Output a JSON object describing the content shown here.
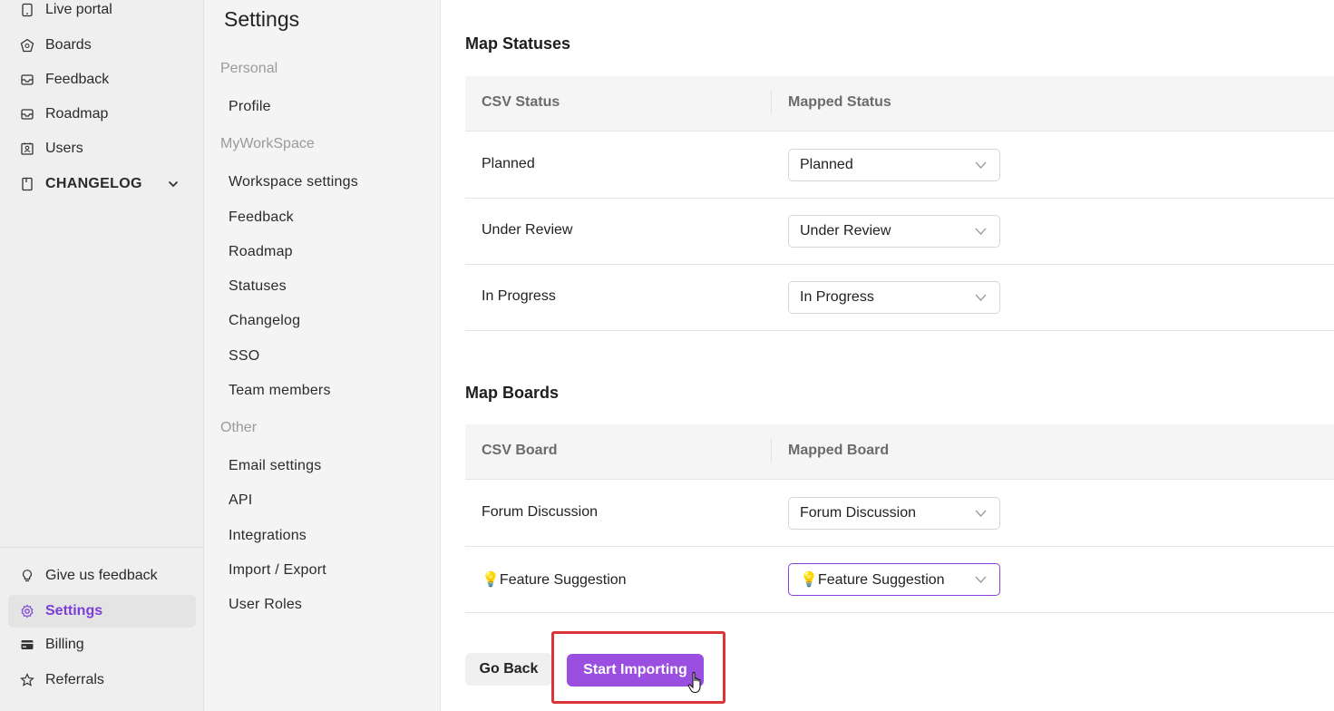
{
  "sidebar": {
    "items": [
      {
        "label": "Live portal",
        "icon": "tablet-icon"
      },
      {
        "label": "Boards",
        "icon": "boards-icon"
      },
      {
        "label": "Feedback",
        "icon": "inbox-icon"
      },
      {
        "label": "Roadmap",
        "icon": "inbox-icon"
      },
      {
        "label": "Users",
        "icon": "contacts-icon"
      },
      {
        "label": "CHANGELOG",
        "icon": "book-icon"
      }
    ],
    "bottom_items": [
      {
        "label": "Give us feedback",
        "icon": "lightbulb-icon"
      },
      {
        "label": "Settings",
        "icon": "gear-icon",
        "active": true
      },
      {
        "label": "Billing",
        "icon": "credit-card-icon"
      },
      {
        "label": "Referrals",
        "icon": "star-icon"
      }
    ]
  },
  "settings_menu": {
    "title": "Settings",
    "sections": [
      {
        "label": "Personal",
        "items": [
          "Profile"
        ]
      },
      {
        "label": "MyWorkSpace",
        "items": [
          "Workspace settings",
          "Feedback",
          "Roadmap",
          "Statuses",
          "Changelog",
          "SSO",
          "Team members"
        ]
      },
      {
        "label": "Other",
        "items": [
          "Email settings",
          "API",
          "Integrations",
          "Import / Export",
          "User Roles"
        ]
      }
    ]
  },
  "map_statuses": {
    "title": "Map Statuses",
    "col_csv": "CSV Status",
    "col_mapped": "Mapped Status",
    "rows": [
      {
        "csv": "Planned",
        "mapped": "Planned"
      },
      {
        "csv": "Under Review",
        "mapped": "Under Review"
      },
      {
        "csv": "In Progress",
        "mapped": "In Progress"
      }
    ]
  },
  "map_boards": {
    "title": "Map Boards",
    "col_csv": "CSV Board",
    "col_mapped": "Mapped Board",
    "rows": [
      {
        "csv": "Forum Discussion",
        "mapped": "Forum Discussion"
      },
      {
        "csv": "💡Feature Suggestion",
        "mapped": "💡Feature Suggestion"
      }
    ]
  },
  "actions": {
    "back_label": "Go Back",
    "start_label": "Start Importing"
  },
  "colors": {
    "accent": "#9a4fe0",
    "active_text": "#7b3fd6",
    "highlight": "#d9353a"
  }
}
